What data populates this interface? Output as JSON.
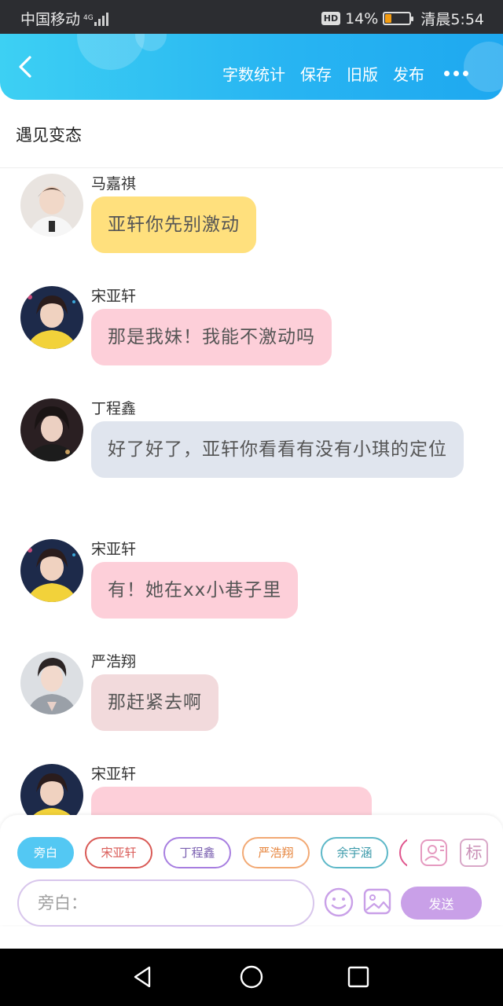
{
  "status_bar": {
    "carrier": "中国移动",
    "network": "4G",
    "hd": "HD",
    "battery": "14%",
    "time": "清晨5:54"
  },
  "header": {
    "actions": [
      "字数统计",
      "保存",
      "旧版",
      "发布"
    ]
  },
  "story": {
    "title": "遇见变态"
  },
  "messages": [
    {
      "sender": "马嘉祺",
      "text": "亚轩你先别激动",
      "bubble_color": "#ffe07d"
    },
    {
      "sender": "宋亚轩",
      "text": "那是我妹！我能不激动吗",
      "bubble_color": "#fdcfd9"
    },
    {
      "sender": "丁程鑫",
      "text": "好了好了，亚轩你看看有没有小琪的定位",
      "bubble_color": "#e0e5ee"
    },
    {
      "sender": "宋亚轩",
      "text": "有！她在xx小巷子里",
      "bubble_color": "#fdcfd9"
    },
    {
      "sender": "严浩翔",
      "text": "那赶紧去啊",
      "bubble_color": "#f2dadc"
    },
    {
      "sender": "宋亚轩",
      "text": "",
      "bubble_color": "#fdcfd9"
    }
  ],
  "composer": {
    "chips": [
      "旁白",
      "宋亚轩",
      "丁程鑫",
      "严浩翔",
      "余宇涵"
    ],
    "tag_icon_label": "标",
    "input_placeholder": "旁白：",
    "send_label": "发送"
  },
  "colors": {
    "accent": "#28b5f2",
    "send_button": "#c9a0e8"
  }
}
